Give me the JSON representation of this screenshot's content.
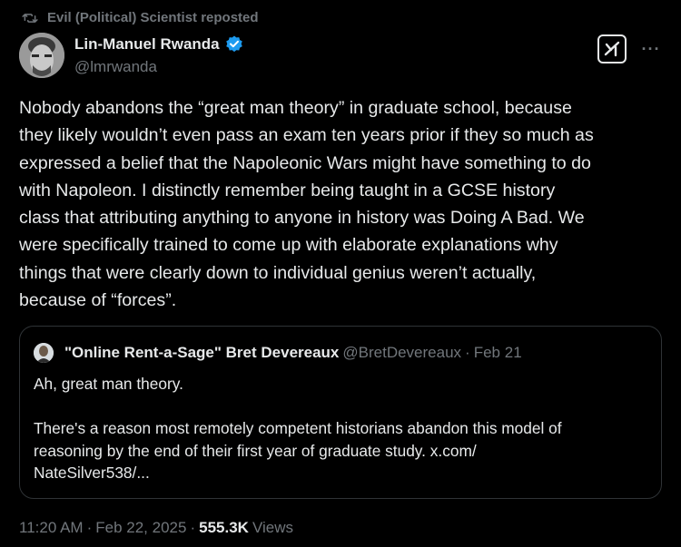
{
  "repost": {
    "label": "Evil (Political) Scientist reposted",
    "icon": "repost-icon"
  },
  "author": {
    "display_name": "Lin-Manuel Rwanda",
    "handle": "@lmrwanda",
    "verified_icon": "verified-badge-icon",
    "verified_color": "#1d9bf0"
  },
  "actions": {
    "grok_icon": "grok-icon",
    "more_label": "···"
  },
  "tweet": {
    "lines": [
      "Nobody abandons the “great man theory” in graduate school, because",
      "they likely wouldn’t even pass an exam ten years prior if they so much as",
      "expressed a belief that the Napoleonic Wars might have something to do",
      "with Napoleon. I distinctly remember being taught in a GCSE history",
      "class that attributing anything to anyone in history was Doing A Bad. We",
      "were specifically trained to come up with elaborate explanations why",
      "things that were clearly down to individual genius weren’t actually,",
      "because of “forces”."
    ]
  },
  "quote": {
    "display_name": "\"Online Rent-a-Sage\" Bret Devereaux",
    "handle": "@BretDevereaux",
    "separator": "·",
    "date": "Feb 21",
    "paragraph1": "Ah, great man theory.",
    "paragraph2_lines": [
      "There's a reason most remotely competent historians abandon this model of",
      "reasoning by the end of their first year of graduate study. x.com/",
      "NateSilver538/..."
    ]
  },
  "meta": {
    "time": "11:20 AM",
    "separator": "·",
    "date": "Feb 22, 2025",
    "views_count": "555.3K",
    "views_label": "Views"
  },
  "colors": {
    "background": "#000000",
    "text": "#e7e9ea",
    "muted": "#71767b",
    "border": "#2f3336",
    "accent": "#1d9bf0"
  }
}
